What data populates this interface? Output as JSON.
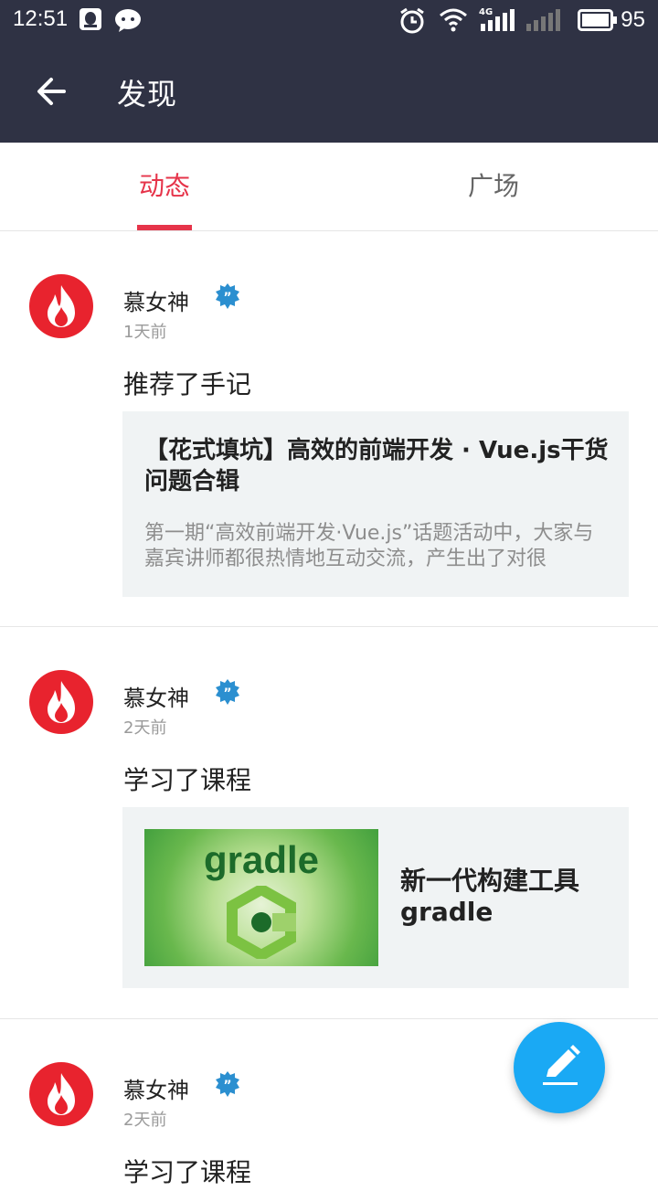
{
  "status_bar": {
    "time": "12:51",
    "network": "4G",
    "battery": "95",
    "icons": [
      "qq-icon",
      "wechat-icon",
      "alarm-icon",
      "wifi-icon",
      "signal-icon",
      "signal-no-service-icon",
      "battery-icon"
    ]
  },
  "header": {
    "title": "发现",
    "back_icon": "arrow-left-icon",
    "background": "#2f3244"
  },
  "tabs": [
    {
      "label": "动态",
      "active": true
    },
    {
      "label": "广场",
      "active": false
    }
  ],
  "accent_color": "#e6344a",
  "posts": [
    {
      "author": "慕女神",
      "time": "1天前",
      "action": "推荐了手记",
      "card": {
        "type": "article",
        "title": "【花式填坑】高效的前端开发 · Vue.js干货问题合辑",
        "desc": "第一期“高效前端开发·Vue.js”话题活动中，大家与嘉宾讲师都很热情地互动交流，产生出了对很"
      }
    },
    {
      "author": "慕女神",
      "time": "2天前",
      "action": "学习了课程",
      "card": {
        "type": "course",
        "thumb_text": "gradle",
        "title": "新一代构建工具gradle"
      }
    },
    {
      "author": "慕女神",
      "time": "2天前",
      "action": "学习了课程"
    }
  ],
  "fab": {
    "icon": "edit-pencil-icon",
    "color": "#1aa9f4"
  }
}
